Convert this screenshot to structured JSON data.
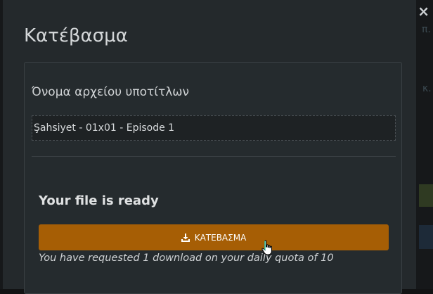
{
  "background": {
    "snippets": [
      "π.",
      "κ."
    ]
  },
  "modal": {
    "title": "Κατέβασμα",
    "close_label": "×",
    "field_label": "Όνομα αρχείου υποτίτλων",
    "filename": "Şahsiyet - 01x01 - Episode 1",
    "ready_title": "Your file is ready",
    "download_label": "ΚΑΤΕΒΑΣΜΑ",
    "download_icon": "download-icon",
    "quota_text": "You have requested 1 download on your daily quota of 10"
  },
  "colors": {
    "accent": "#a65e05",
    "modal_bg": "#24292c"
  }
}
